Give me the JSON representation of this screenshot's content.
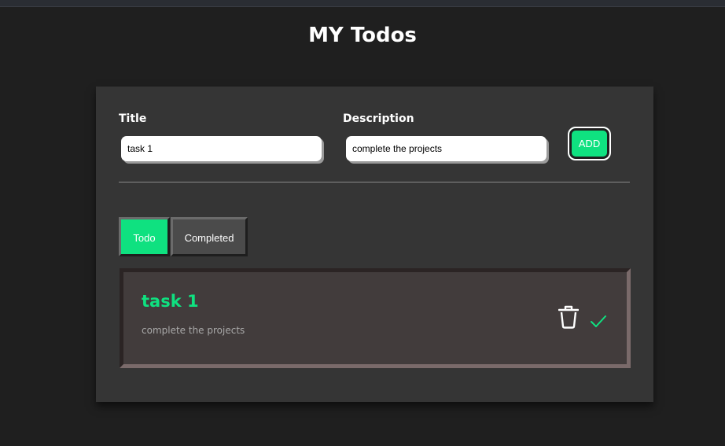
{
  "header": {
    "title": "MY Todos"
  },
  "form": {
    "title_label": "Title",
    "title_value": "task 1",
    "description_label": "Description",
    "description_value": "complete the projects",
    "add_label": "ADD"
  },
  "tabs": [
    {
      "label": "Todo",
      "active": true
    },
    {
      "label": "Completed",
      "active": false
    }
  ],
  "todos": [
    {
      "title": "task 1",
      "description": "complete the projects",
      "actions": [
        "trash-icon",
        "check-icon"
      ]
    }
  ],
  "colors": {
    "accent": "#0fe180",
    "background": "#1f1f1f",
    "card": "#353535",
    "todo_item": "#423c3c",
    "tab_inactive": "#4b4b4b"
  }
}
